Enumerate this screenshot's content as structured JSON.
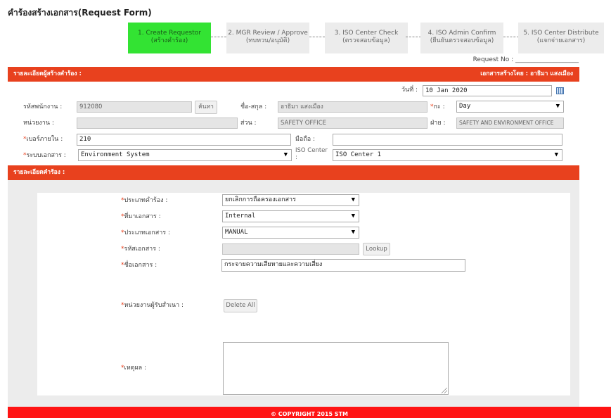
{
  "page": {
    "title": "คำร้องสร้างเอกสาร(Request Form)"
  },
  "steps": [
    {
      "line1": "1. Create Requestor",
      "line2": "(สร้างคำร้อง)",
      "active": true
    },
    {
      "line1": "2. MGR Review / Approve",
      "line2": "(ทบทวน/อนุมัติ)",
      "active": false
    },
    {
      "line1": "3. ISO Center Check",
      "line2": "(ตรวจสอบข้อมูล)",
      "active": false
    },
    {
      "line1": "4. ISO Admin Confirm",
      "line2": "(ยืนยันตรวจสอบข้อมูล)",
      "active": false
    },
    {
      "line1": "5. ISO Center Distribute",
      "line2": "(แจกจ่ายเอกสาร)",
      "active": false
    }
  ],
  "request_no": "Request No : ____________________",
  "requester_section": {
    "title": "รายละเอียดผู้สร้างคำร้อง :",
    "created_by": "เอกสารสร้างโดย : อาธิมา แสงเมือง",
    "date_label": "วันที่ :",
    "date_value": "10 Jan 2020",
    "employee_id_label": "รหัสพนักงาน :",
    "employee_id_value": "912080",
    "search_button": "ค้นหา",
    "name_label": "ชื่อ-สกุล :",
    "name_value": "อาธิมา แสงเมือง",
    "shift_label": "กะ :",
    "shift_value": "Day",
    "unit_label": "หน่วยงาน :",
    "unit_value": "",
    "section_label": "ส่วน :",
    "section_value": "SAFETY OFFICE",
    "division_label": "ฝ่าย :",
    "division_value": "SAFETY AND ENVIRONMENT OFFICE",
    "ext_label": "เบอร์ภายใน :",
    "ext_value": "210",
    "mobile_label": "มือถือ :",
    "mobile_value": "",
    "doc_system_label": "ระบบเอกสาร :",
    "doc_system_value": "Environment System",
    "iso_center_label": "ISO Center",
    "iso_center_colon": ":",
    "iso_center_value": "ISO Center 1"
  },
  "request_section": {
    "title": "รายละเอียดคำร้อง :",
    "request_type_label": "ประเภทคำร้อง :",
    "request_type_value": "ยกเลิกการถือครองเอกสาร",
    "doc_source_label": "ที่มาเอกสาร :",
    "doc_source_value": "Internal",
    "doc_type_label": "ประเภทเอกสาร :",
    "doc_type_value": "MANUAL",
    "doc_code_label": "รหัสเอกสาร :",
    "doc_code_value": "",
    "lookup_button": "Lookup",
    "doc_name_label": "ชื่อเอกสาร :",
    "doc_name_value": "กระจายความเสียหายและความเสี่ยง",
    "receiving_unit_label": "หน่วยงานผู้รับสำเนา :",
    "delete_all_button": "Delete All",
    "reason_label": "เหตุผล :",
    "reason_value": ""
  },
  "footer": {
    "text": "© COPYRIGHT 2015 STM"
  },
  "colors": {
    "accent": "#e8411e",
    "active_step": "#33e333",
    "footer": "#ff1414"
  }
}
